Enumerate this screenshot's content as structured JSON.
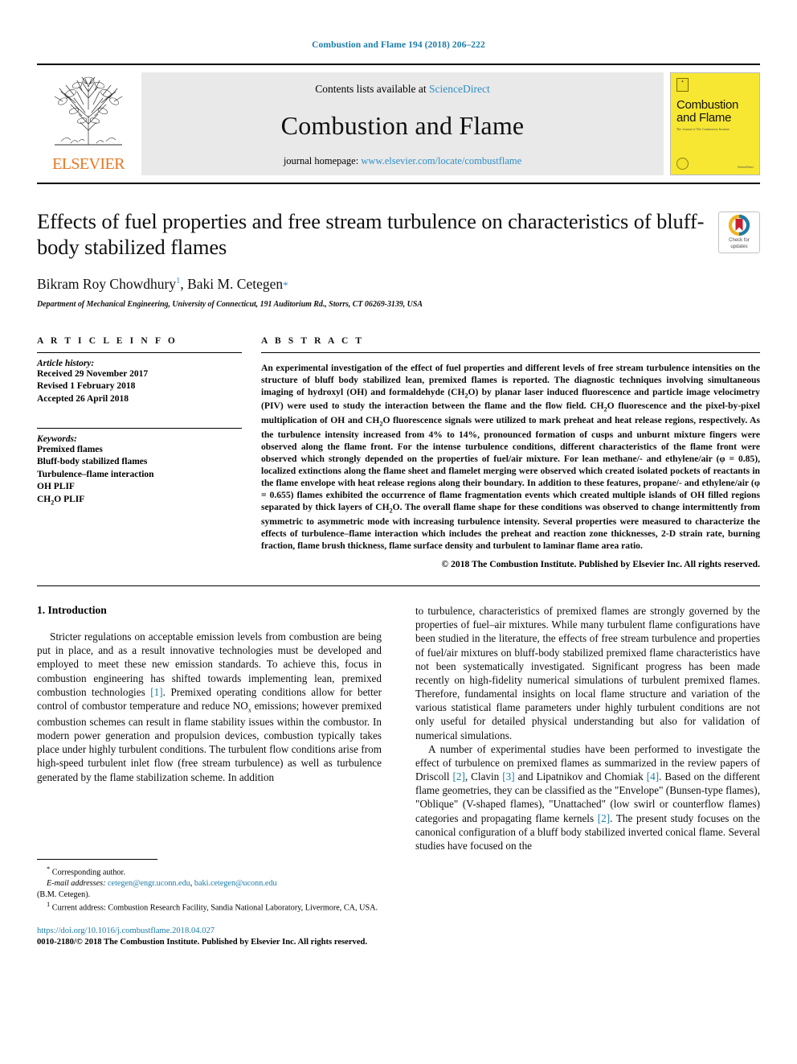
{
  "running_head": "Combustion and Flame 194 (2018) 206–222",
  "masthead": {
    "publisher_name": "ELSEVIER",
    "contents_prefix": "Contents lists available at",
    "contents_link": "ScienceDirect",
    "journal_title": "Combustion and Flame",
    "homepage_prefix": "journal homepage:",
    "homepage_link": "www.elsevier.com/locate/combustflame",
    "cover": {
      "title_line1": "Combustion",
      "title_line2": "and Flame",
      "subtitle": "The Journal of The Combustion Institute",
      "brand": "ScienceDirect"
    }
  },
  "article": {
    "title": "Effects of fuel properties and free stream turbulence on characteristics of bluff-body stabilized flames",
    "authors_part1": "Bikram Roy Chowdhury",
    "authors_sup1": "1",
    "authors_part2": ", Baki M. Cetegen",
    "authors_star": "*",
    "affiliation": "Department of Mechanical Engineering, University of Connecticut, 191 Auditorium Rd., Storrs, CT 06269-3139, USA",
    "crossmark_line1": "Check for",
    "crossmark_line2": "updates"
  },
  "article_info": {
    "heading": "A R T I C L E   I N F O",
    "history_label": "Article history:",
    "history": [
      "Received 29 November 2017",
      "Revised 1 February 2018",
      "Accepted 26 April 2018"
    ],
    "keywords_label": "Keywords:",
    "keywords": [
      "Premixed flames",
      "Bluff-body stabilized flames",
      "Turbulence–flame interaction",
      "OH PLIF",
      "CH2O PLIF"
    ]
  },
  "abstract": {
    "heading": "A B S T R A C T",
    "text": "An experimental investigation of the effect of fuel properties and different levels of free stream turbulence intensities on the structure of bluff body stabilized lean, premixed flames is reported. The diagnostic techniques involving simultaneous imaging of hydroxyl (OH) and formaldehyde (CH2O) by planar laser induced fluorescence and particle image velocimetry (PIV) were used to study the interaction between the flame and the flow field. CH2O fluorescence and the pixel-by-pixel multiplication of OH and CH2O fluorescence signals were utilized to mark preheat and heat release regions, respectively. As the turbulence intensity increased from 4% to 14%, pronounced formation of cusps and unburnt mixture fingers were observed along the flame front. For the intense turbulence conditions, different characteristics of the flame front were observed which strongly depended on the properties of fuel/air mixture. For lean methane/- and ethylene/air (φ = 0.85), localized extinctions along the flame sheet and flamelet merging were observed which created isolated pockets of reactants in the flame envelope with heat release regions along their boundary. In addition to these features, propane/- and ethylene/air (φ = 0.655) flames exhibited the occurrence of flame fragmentation events which created multiple islands of OH filled regions separated by thick layers of CH2O. The overall flame shape for these conditions was observed to change intermittently from symmetric to asymmetric mode with increasing turbulence intensity. Several properties were measured to characterize the effects of turbulence–flame interaction which includes the preheat and reaction zone thicknesses, 2-D strain rate, burning fraction, flame brush thickness, flame surface density and turbulent to laminar flame area ratio.",
    "copyright": "© 2018 The Combustion Institute. Published by Elsevier Inc. All rights reserved."
  },
  "introduction": {
    "section_number_title": "1. Introduction",
    "left_paragraph_1": "Stricter regulations on acceptable emission levels from combustion are being put in place, and as a result innovative technologies must be developed and employed to meet these new emission standards. To achieve this, focus in combustion engineering has shifted towards implementing lean, premixed combustion technologies [1]. Premixed operating conditions allow for better control of combustor temperature and reduce NOx emissions; however premixed combustion schemes can result in flame stability issues within the combustor. In modern power generation and propulsion devices, combustion typically takes place under highly turbulent conditions. The turbulent flow conditions arise from high-speed turbulent inlet flow (free stream turbulence) as well as turbulence generated by the flame stabilization scheme. In addition",
    "right_paragraph_1": "to turbulence, characteristics of premixed flames are strongly governed by the properties of fuel–air mixtures. While many turbulent flame configurations have been studied in the literature, the effects of free stream turbulence and properties of fuel/air mixtures on bluff-body stabilized premixed flame characteristics have not been systematically investigated. Significant progress has been made recently on high-fidelity numerical simulations of turbulent premixed flames. Therefore, fundamental insights on local flame structure and variation of the various statistical flame parameters under highly turbulent conditions are not only useful for detailed physical understanding but also for validation of numerical simulations.",
    "right_paragraph_2": "A number of experimental studies have been performed to investigate the effect of turbulence on premixed flames as summarized in the review papers of Driscoll [2], Clavin [3] and Lipatnikov and Chomiak [4]. Based on the different flame geometries, they can be classified as the \"Envelope\" (Bunsen-type flames), \"Oblique\" (V-shaped flames), \"Unattached\" (low swirl or counterflow flames) categories and propagating flame kernels [2]. The present study focuses on the canonical configuration of a bluff body stabilized inverted conical flame. Several studies have focused on the"
  },
  "footnotes": {
    "corresponding_marker": "*",
    "corresponding_text": "Corresponding author.",
    "email_label": "E-mail addresses:",
    "email_1": "cetegen@engr.uconn.edu",
    "email_sep": ",",
    "email_2": "baki.cetegen@uconn.edu",
    "email_owner": "(B.M. Cetegen).",
    "footnote_marker_1": "1",
    "footnote_text_1": "Current address: Combustion Research Facility, Sandia National Laboratory, Livermore, CA, USA.",
    "doi": "https://doi.org/10.1016/j.combustflame.2018.04.027",
    "issn_line": "0010-2180/© 2018 The Combustion Institute. Published by Elsevier Inc. All rights reserved."
  },
  "colors": {
    "link_blue": "#1b7ca8",
    "science_direct_blue": "#2d8fc9",
    "elsevier_orange": "#e87722",
    "cover_yellow": "#f7e733",
    "masthead_gray": "#e9e9e9"
  }
}
